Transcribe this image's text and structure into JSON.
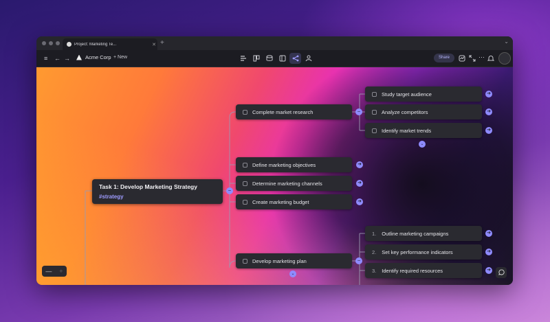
{
  "window": {
    "tab_title": "Project: Marketing Te...",
    "tab_close": "✕",
    "new_tab": "+",
    "chevron": "⌄"
  },
  "toolbar": {
    "workspace": "Acme Corp",
    "new_label": "+ New",
    "share_label": "Share"
  },
  "mindmap": {
    "root": {
      "title": "Task 1: Develop Marketing Strategy",
      "tag": "#strategy"
    },
    "branches": [
      {
        "label": "Complete market research"
      },
      {
        "label": "Define marketing objectives"
      },
      {
        "label": "Determine marketing channels"
      },
      {
        "label": "Create marketing budget"
      },
      {
        "label": "Develop marketing plan"
      }
    ],
    "research_children": [
      {
        "label": "Study target audience"
      },
      {
        "label": "Analyze competitors"
      },
      {
        "label": "Identify market trends"
      }
    ],
    "plan_children": [
      {
        "num": "1.",
        "label": "Outline marketing campaigns"
      },
      {
        "num": "2.",
        "label": "Set key performance indicators"
      },
      {
        "num": "3.",
        "label": "Identify required resources"
      }
    ]
  },
  "controls": {
    "zoom_out": "—",
    "zoom_in": "+"
  },
  "icons": {
    "sidebar": "≡",
    "back": "←",
    "forward": "→",
    "arrow": "➔",
    "collapse": "−",
    "expand": "⌄",
    "chat": "chat-bubble-icon"
  },
  "colors": {
    "accent": "#8f8bff",
    "node_bg": "#2a2a30",
    "tag": "#9f9cff"
  }
}
